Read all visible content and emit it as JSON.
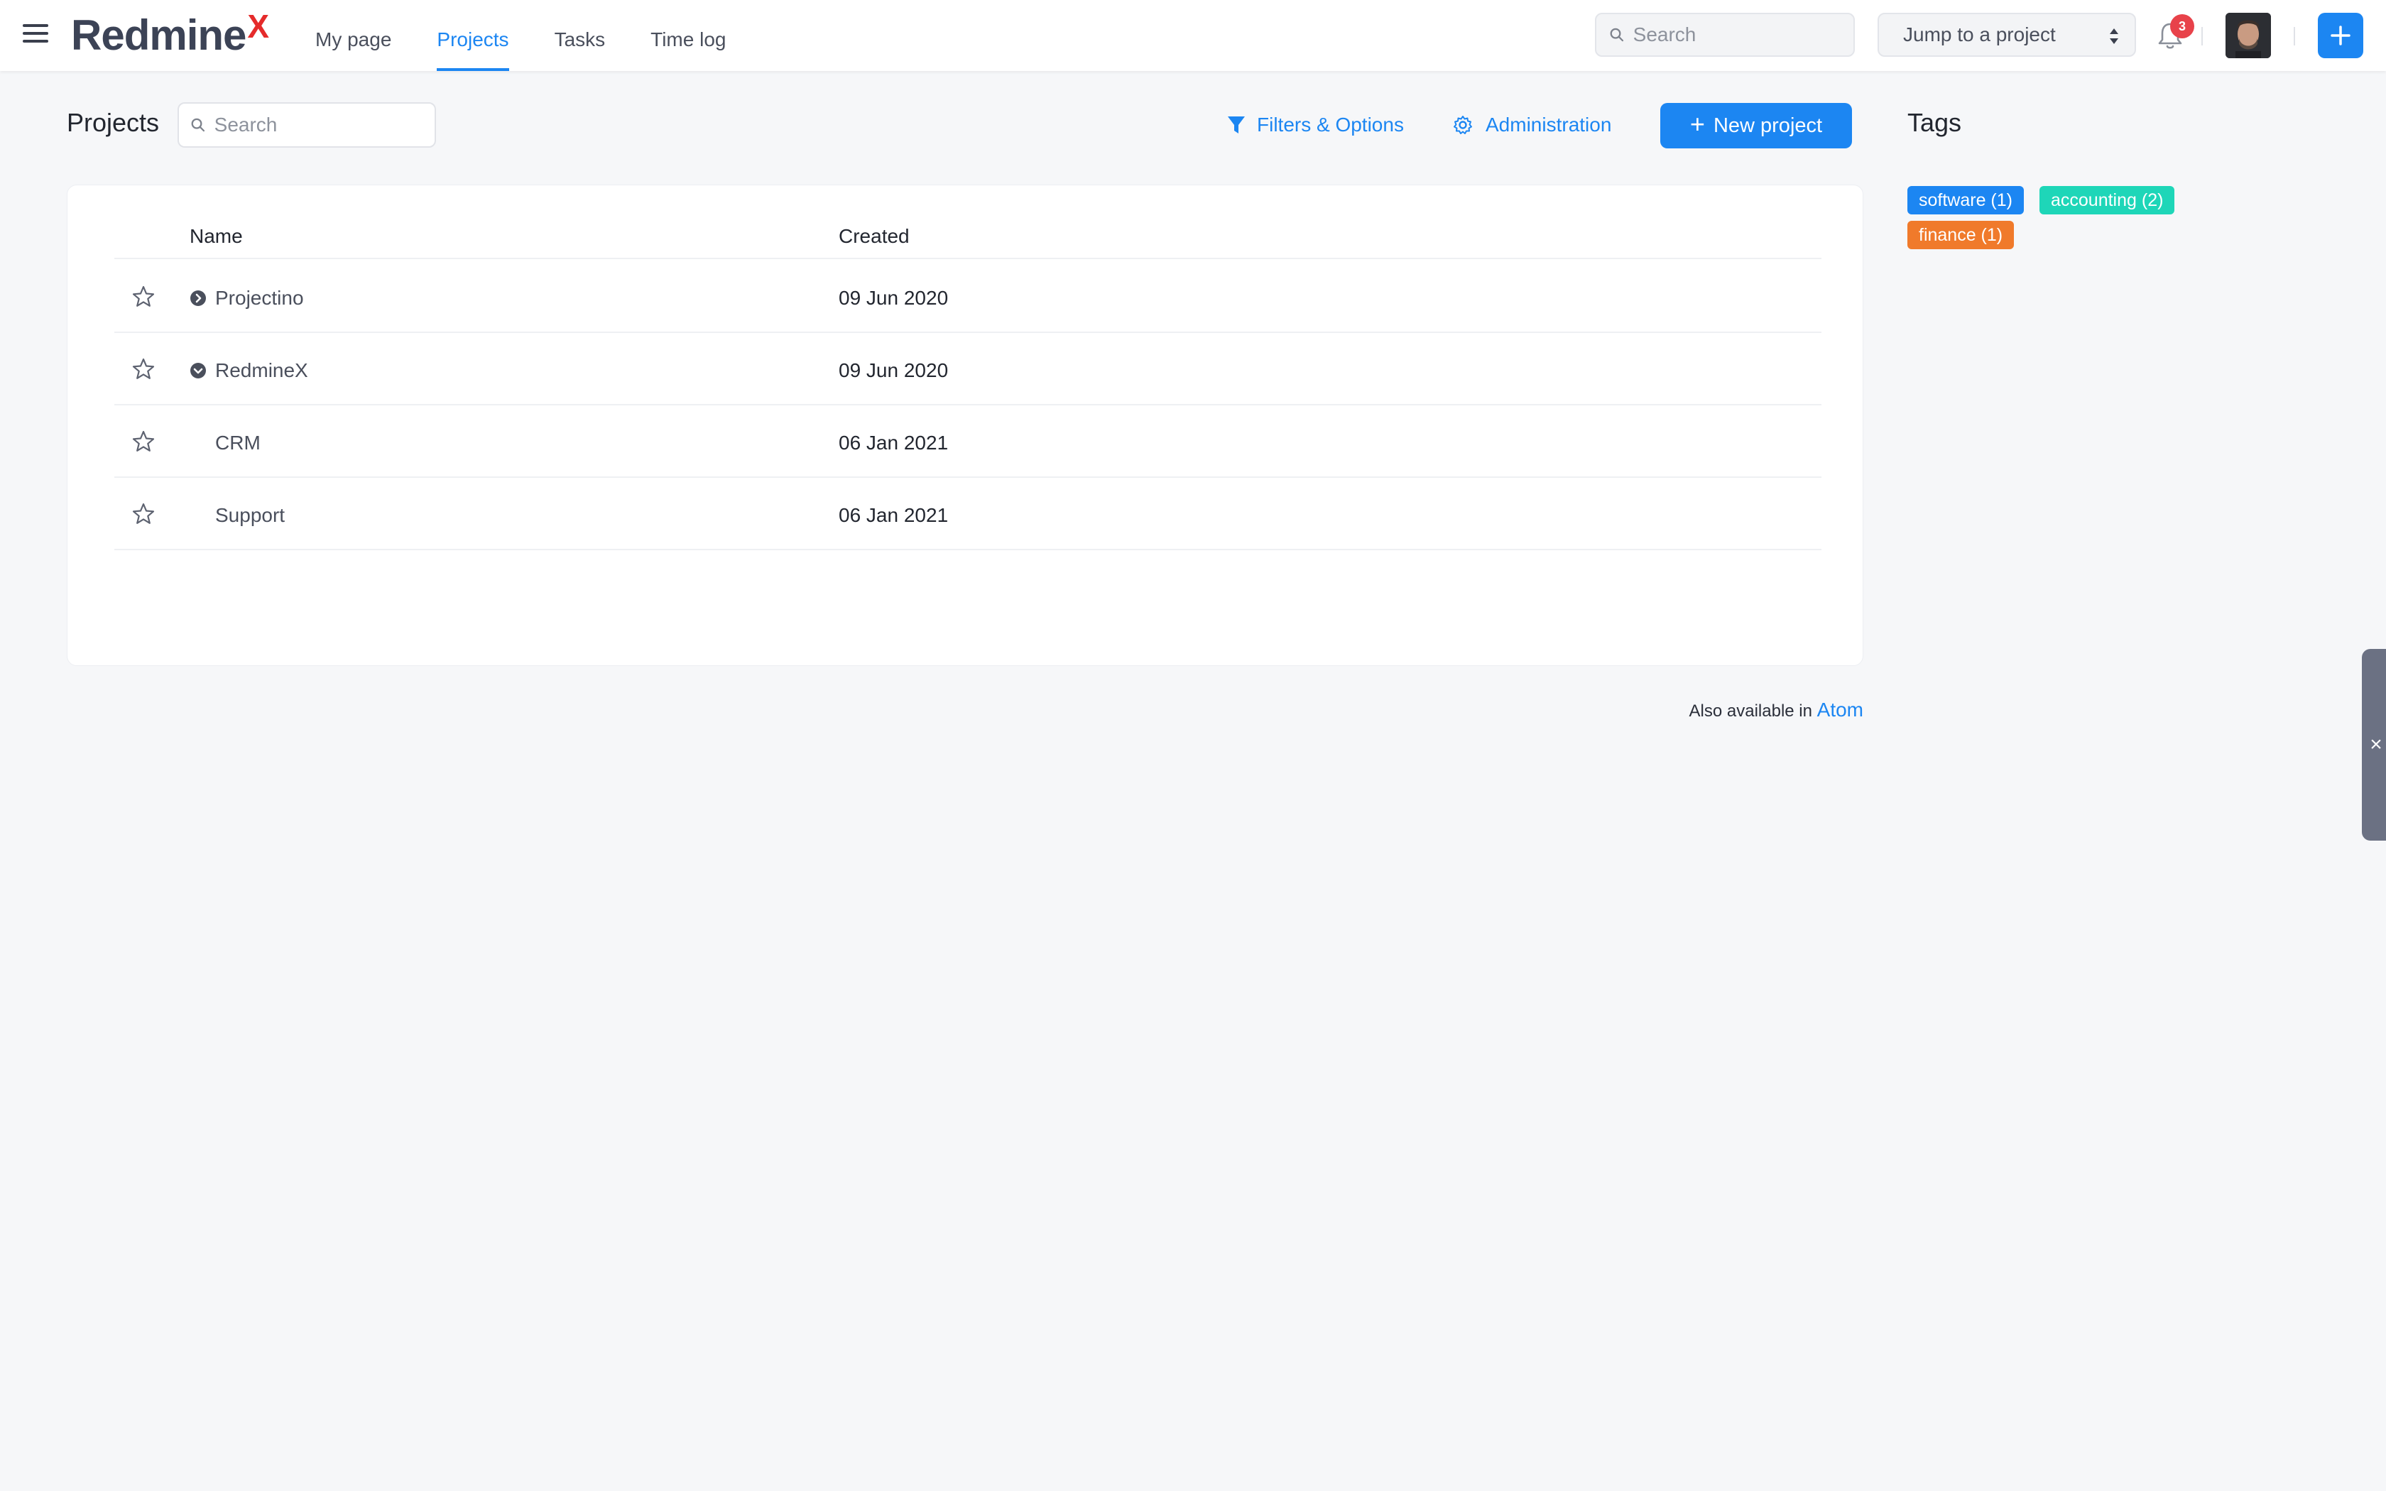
{
  "app": {
    "logo_main": "Redmine",
    "logo_accent": "X"
  },
  "nav": {
    "items": [
      {
        "label": "My page",
        "active": false
      },
      {
        "label": "Projects",
        "active": true
      },
      {
        "label": "Tasks",
        "active": false
      },
      {
        "label": "Time log",
        "active": false
      }
    ]
  },
  "header": {
    "search_placeholder": "Search",
    "jump_label": "Jump to a project",
    "notifications_count": "3"
  },
  "page": {
    "title": "Projects",
    "search_placeholder": "Search",
    "filters_label": "Filters & Options",
    "admin_label": "Administration",
    "new_project_label": "New project"
  },
  "table": {
    "columns": [
      "Name",
      "Created"
    ],
    "rows": [
      {
        "name": "Projectino",
        "created": "09 Jun 2020",
        "expander": "collapsed"
      },
      {
        "name": "RedmineX",
        "created": "09 Jun 2020",
        "expander": "expanded"
      },
      {
        "name": "CRM",
        "created": "06 Jan 2021",
        "expander": "none"
      },
      {
        "name": "Support",
        "created": "06 Jan 2021",
        "expander": "none"
      }
    ]
  },
  "atom": {
    "prefix": "Also available in",
    "link": "Atom"
  },
  "tags": {
    "title": "Tags",
    "items": [
      {
        "label": "software (1)",
        "color": "#1c86f2"
      },
      {
        "label": "accounting (2)",
        "color": "#1ed6b8"
      },
      {
        "label": "finance (1)",
        "color": "#f07a2b"
      }
    ]
  },
  "side_handle": {
    "close_glyph": "×"
  },
  "colors": {
    "accent": "#1c86f2",
    "logo_accent": "#e52b2b",
    "badge": "#e8424a"
  }
}
